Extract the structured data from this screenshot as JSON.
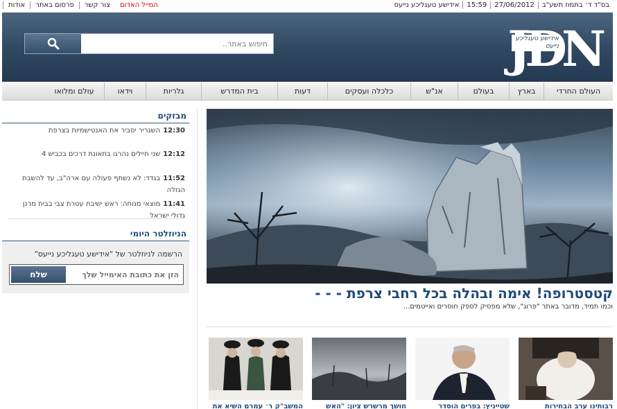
{
  "topbar": {
    "date_hebrew": "בס\"ד  ד׳ בתמוז תשע\"ב",
    "date": "27/06/2012",
    "time": "15:59",
    "site_name": "אידישע טעגליכע נייעס",
    "links": [
      "המייל האדום",
      "צור קשר",
      "פרסום באתר",
      "אודות"
    ]
  },
  "header": {
    "logo_text": "JDN",
    "logo_subtext": "אידישע טעגליכע נייעס",
    "search_placeholder": "חיפוש באתר..",
    "search_icon": "magnifier-icon",
    "brand_color": "#2f475f"
  },
  "nav": {
    "items": [
      "העולם החרדי",
      "בארץ",
      "בעולם",
      "אנ\"ש",
      "כלכלה ועסקים",
      "דעות",
      "בית המדרש",
      "גלריות",
      "וידאו",
      "עולם ומלואו"
    ]
  },
  "sidebar": {
    "breaking_title": "מבזקים",
    "news": [
      {
        "time": "12:30",
        "text": "השגריר יסביר את האנטישמיות בצרפת"
      },
      {
        "time": "12:12",
        "text": "שני חיילים נהרגו בתאונת דרכים בכביש 4"
      },
      {
        "time": "11:52",
        "text": "בגדד: לא נשתף פעולה עם ארה\"ב, עד להשבת הגזלה"
      },
      {
        "time": "11:41",
        "text": "מוצאי מנוחה: ראש ישיבת עטרת צבי בבית מרנן גדולי ישראל"
      }
    ],
    "newsletter_title": "הניוזלטר היומי",
    "newsletter_text": "הרשמה לניוזלטר של \"אידישע טעגליכע נייעס\"",
    "newsletter_placeholder": "הזן את כתובת האימייל שלך",
    "newsletter_button": "שלח"
  },
  "main": {
    "headline": "קטסטרופה! אימה ובהלה בכל רחבי צרפת - - -",
    "subline": "וכמו תמיד, מדובר באתר \"פרוג\", שלא מפסיק לספק חוסרים ואייטמים...",
    "thumbs": [
      "רבותינו ערב הבחירות",
      "שטייניץ: בפרים הוסדר",
      "חושך מרשרש ציון: \"האש",
      "המשב\"ק ר׳ עמרם השיא את"
    ]
  }
}
